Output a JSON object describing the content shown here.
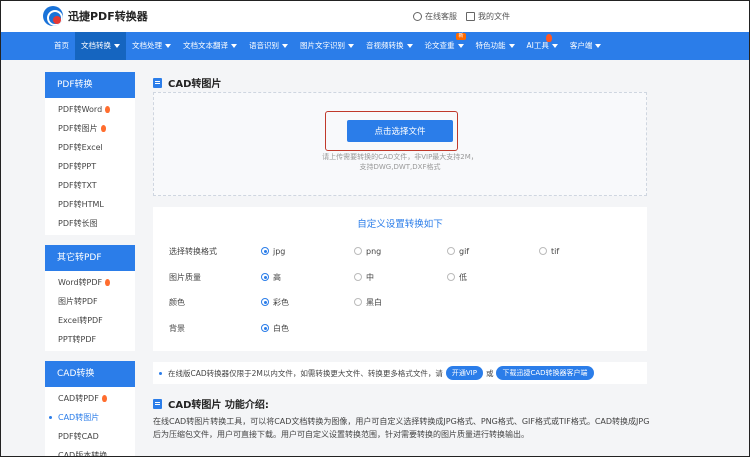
{
  "header": {
    "logo_text": "迅捷PDF转换器",
    "service_link": "在线客服",
    "docs_link": "我的文件"
  },
  "nav": {
    "items": [
      {
        "label": "首页",
        "caret": false
      },
      {
        "label": "文档转换",
        "caret": true,
        "active": true
      },
      {
        "label": "文档处理",
        "caret": true
      },
      {
        "label": "文档文本翻译",
        "caret": true
      },
      {
        "label": "语音识别",
        "caret": true
      },
      {
        "label": "图片文字识别",
        "caret": true
      },
      {
        "label": "音视频转换",
        "caret": true
      },
      {
        "label": "论文查重",
        "caret": true,
        "badge": "新"
      },
      {
        "label": "特色功能",
        "caret": true
      },
      {
        "label": "AI工具",
        "caret": true,
        "hot": true
      },
      {
        "label": "客户端",
        "caret": true
      }
    ]
  },
  "sidebar": {
    "groups": [
      {
        "title": "PDF转换",
        "items": [
          {
            "label": "PDF转Word",
            "hot": true
          },
          {
            "label": "PDF转图片",
            "hot": true
          },
          {
            "label": "PDF转Excel"
          },
          {
            "label": "PDF转PPT"
          },
          {
            "label": "PDF转TXT"
          },
          {
            "label": "PDF转HTML"
          },
          {
            "label": "PDF转长图"
          }
        ]
      },
      {
        "title": "其它转PDF",
        "items": [
          {
            "label": "Word转PDF",
            "hot": true
          },
          {
            "label": "图片转PDF"
          },
          {
            "label": "Excel转PDF"
          },
          {
            "label": "PPT转PDF"
          }
        ]
      },
      {
        "title": "CAD转换",
        "items": [
          {
            "label": "CAD转PDF",
            "hot": true
          },
          {
            "label": "CAD转图片",
            "active": true
          },
          {
            "label": "PDF转CAD"
          },
          {
            "label": "CAD版本转换"
          }
        ]
      }
    ]
  },
  "main": {
    "title": "CAD转图片",
    "upload_button": "点击选择文件",
    "upload_hint_1": "请上传需要转换的CAD文件，非VIP最大支持2M，",
    "upload_hint_2": "支持DWG,DWT,DXF格式",
    "settings_title": "自定义设置转换如下",
    "settings": {
      "format_label": "选择转换格式",
      "format_options": [
        "jpg",
        "png",
        "gif",
        "tif"
      ],
      "quality_label": "图片质量",
      "quality_options": [
        "高",
        "中",
        "低"
      ],
      "color_label": "颜色",
      "color_options": [
        "彩色",
        "黑白"
      ],
      "bg_label": "背景",
      "bg_options": [
        "白色"
      ]
    },
    "notice_text": "在线版CAD转换器仅限于2M以内文件，如需转换更大文件、转换更多格式文件，请",
    "notice_vip": "开通VIP",
    "notice_or": "或",
    "notice_download": "下载迅捷CAD转换器客户端",
    "intro_title": "CAD转图片 功能介绍:",
    "intro_text": "在线CAD转图片转换工具，可以将CAD文档转换为图像，用户可自定义选择转换成JPG格式、PNG格式、GIF格式或TIF格式。CAD转换成JPG后为压缩包文件，用户可直接下载。用户可自定义设置转换范围，针对需要转换的图片质量进行转换输出。"
  },
  "colors": {
    "primary": "#2b7de9",
    "nav_active": "#1565c0",
    "highlight": "#c0392b"
  }
}
